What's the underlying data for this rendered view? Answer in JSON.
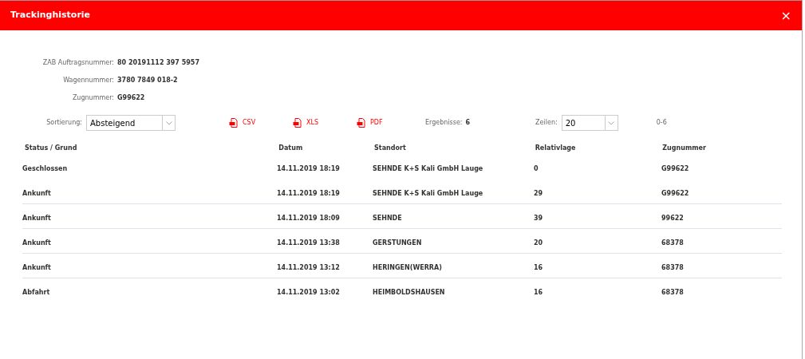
{
  "dialog": {
    "title": "Trackinghistorie",
    "close": "×"
  },
  "info": [
    {
      "label": "ZAB Auftragsnummer:",
      "value": "80 20191112 397 5957"
    },
    {
      "label": "Wagennummer:",
      "value": "3780 7849 018-2"
    },
    {
      "label": "Zugnummer:",
      "value": "G99622"
    }
  ],
  "toolbar": {
    "sort_label": "Sortierung:",
    "sort_value": "Absteigend",
    "exports": [
      "CSV",
      "XLS",
      "PDF"
    ],
    "results_label": "Ergebnisse:",
    "results_value": "6",
    "rows_label": "Zeilen:",
    "rows_value": "20",
    "range": "0-6"
  },
  "table": {
    "columns": [
      "Status / Grund",
      "Datum",
      "Standort",
      "Relativlage",
      "Zugnummer"
    ],
    "rows": [
      [
        "Geschlossen",
        "14.11.2019 18:19",
        "SEHNDE K+S Kali GmbH Lauge",
        "0",
        "G99622"
      ],
      [
        "Ankunft",
        "14.11.2019 18:19",
        "SEHNDE K+S Kali GmbH Lauge",
        "29",
        "G99622"
      ],
      [
        "Ankunft",
        "14.11.2019 18:09",
        "SEHNDE",
        "39",
        "99622"
      ],
      [
        "Ankunft",
        "14.11.2019 13:38",
        "GERSTUNGEN",
        "20",
        "68378"
      ],
      [
        "Ankunft",
        "14.11.2019 13:12",
        "HERINGEN(WERRA)",
        "16",
        "68378"
      ],
      [
        "Abfahrt",
        "14.11.2019 13:02",
        "HEIMBOLDSHAUSEN",
        "16",
        "68378"
      ]
    ]
  }
}
